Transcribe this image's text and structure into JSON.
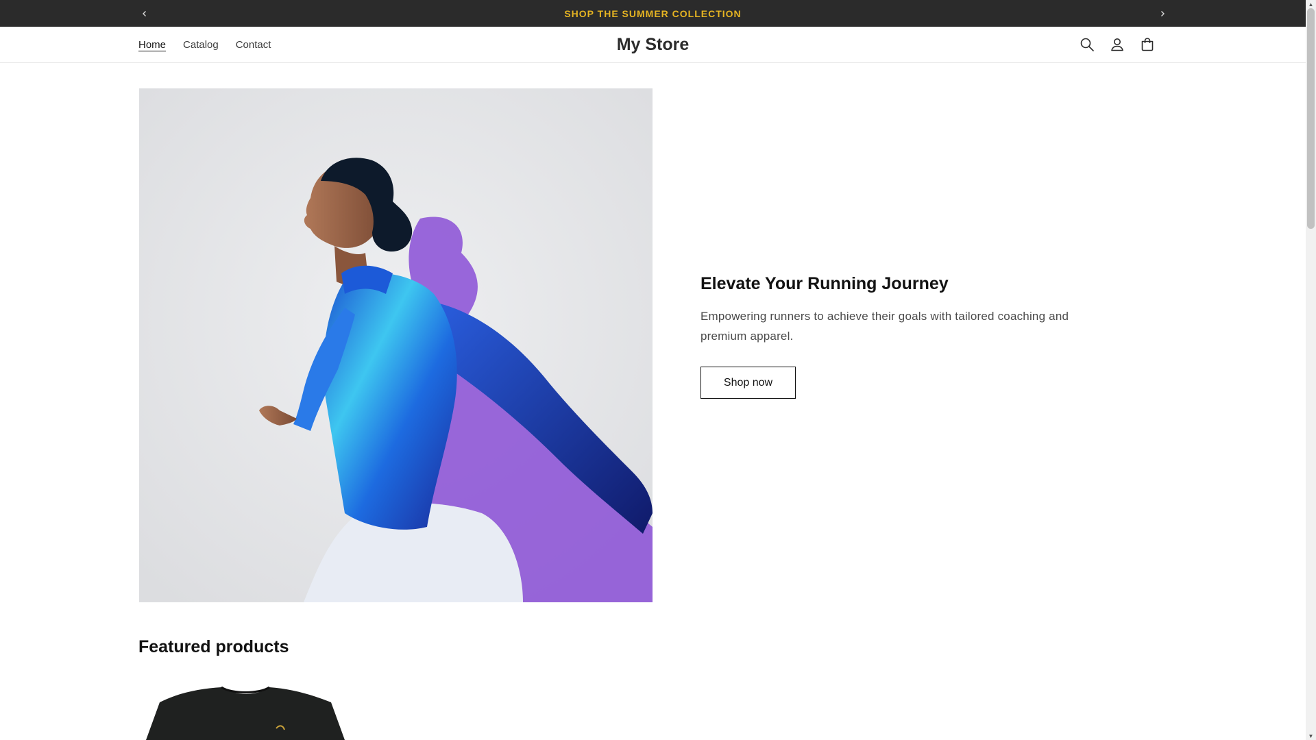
{
  "announcement": {
    "text": "SHOP THE SUMMER COLLECTION",
    "prev_icon": "chevron-left-icon",
    "next_icon": "chevron-right-icon",
    "text_color": "#e6b422",
    "background": "#2b2b2b"
  },
  "header": {
    "logo": "My Store",
    "nav": [
      {
        "label": "Home",
        "active": true
      },
      {
        "label": "Catalog",
        "active": false
      },
      {
        "label": "Contact",
        "active": false
      }
    ],
    "icons": [
      "search-icon",
      "account-icon",
      "cart-icon"
    ]
  },
  "hero": {
    "title": "Elevate Your Running Journey",
    "description": "Empowering runners to achieve their goals with tailored coaching and premium apparel.",
    "button_label": "Shop now",
    "image_subject": "runner in metallic blue jacket"
  },
  "featured": {
    "title": "Featured products"
  }
}
